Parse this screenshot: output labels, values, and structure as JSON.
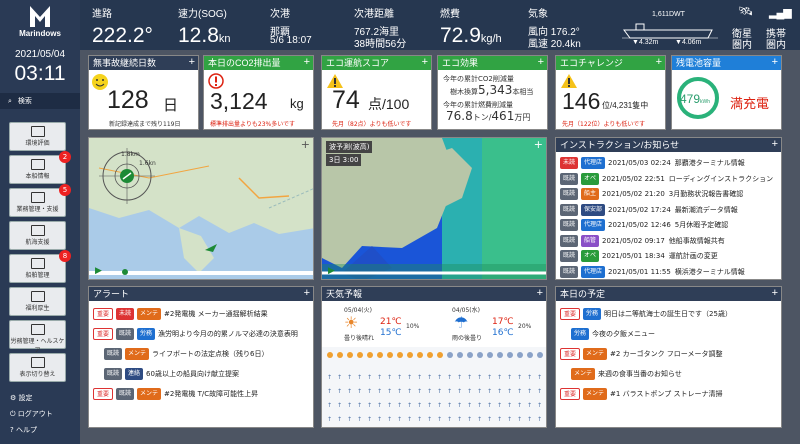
{
  "sidebar": {
    "logo": "Marindows",
    "date": "2021/05/04",
    "time": "03:11",
    "search": "検索",
    "menu": [
      {
        "label": "環境評価",
        "badge": ""
      },
      {
        "label": "本船情報",
        "badge": "2"
      },
      {
        "label": "業務管理・支援",
        "badge": "5"
      },
      {
        "label": "航海支援",
        "badge": ""
      },
      {
        "label": "船舶管理",
        "badge": "8"
      },
      {
        "label": "福利厚生",
        "badge": ""
      },
      {
        "label": "労務管理・ヘルスケア",
        "badge": ""
      },
      {
        "label": "表示切り替え",
        "badge": ""
      }
    ],
    "settings": "設定",
    "logout": "ログアウト",
    "help": "ヘルプ"
  },
  "topbar": {
    "course": {
      "label": "進路",
      "value": "222.2°"
    },
    "speed": {
      "label": "速力(SOG)",
      "value": "12.8",
      "unit": "kn"
    },
    "next_port": {
      "label": "次港",
      "name": "那覇",
      "eta": "5/6 18:07"
    },
    "distance": {
      "label": "次港距離",
      "nm": "767.2海里",
      "time": "38時間56分"
    },
    "fuel": {
      "label": "燃費",
      "value": "72.9",
      "unit": "kg/h"
    },
    "weather": {
      "label": "気象",
      "wind_dir": "風向 176.2°",
      "wind_speed": "風速 20.4kn"
    },
    "ship": {
      "dwt": "1,611DWT",
      "left": "4.32m",
      "right": "4.06m"
    },
    "satellite": {
      "line1": "衛星",
      "line2": "圏内"
    },
    "mobile": {
      "line1": "携帯",
      "line2": "圏内"
    }
  },
  "cards": {
    "no_accident": {
      "title": "無事故継続日数",
      "value": "128",
      "unit": "日",
      "foot": "新記録達成まで残り119日"
    },
    "co2": {
      "title": "本日のCO2排出量",
      "value": "3,124",
      "unit": "kg",
      "foot": "標準排出量よりも23%多いです"
    },
    "eco_score": {
      "title": "エコ運航スコア",
      "value": "74",
      "unit": "点/100",
      "foot": "先月（82点）よりも低いです"
    },
    "eco_effect": {
      "title": "エコ効果",
      "l1": "今年の累計CO2削減量",
      "l2a": "樹木換算",
      "l2b": "5,343",
      "l2c": "本相当",
      "l3": "今年の累計燃費削減量",
      "l4a": "76.8",
      "l4b": "トン/",
      "l4c": "461",
      "l4d": "万円"
    },
    "eco_challenge": {
      "title": "エコチャレンジ",
      "rank": "146",
      "unit": "位/4,231隻中",
      "foot": "先月（122位）よりも低いです"
    },
    "battery": {
      "title": "残電池容量",
      "value": "479",
      "unit": "kWh",
      "status": "満充電"
    },
    "notices": {
      "title": "インストラクション/お知らせ",
      "rows": [
        {
          "t1": "未読",
          "t2": "代理店",
          "c2": "t-blue",
          "time": "2021/05/03 02:24",
          "text": "那覇港ターミナル情報"
        },
        {
          "t1": "既読",
          "t2": "オペ",
          "c2": "t-green",
          "time": "2021/05/02 22:51",
          "text": "ローディングインストラクション"
        },
        {
          "t1": "既読",
          "t2": "船主",
          "c2": "t-orange",
          "time": "2021/05/02 21:20",
          "text": "3月勤務状況報告書確認"
        },
        {
          "t1": "既読",
          "t2": "保安部",
          "c2": "t-navy",
          "time": "2021/05/02 17:24",
          "text": "最新潮流データ情報"
        },
        {
          "t1": "既読",
          "t2": "代理店",
          "c2": "t-blue",
          "time": "2021/05/02 12:46",
          "text": "5月休暇予定確認"
        },
        {
          "t1": "既読",
          "t2": "船管",
          "c2": "t-purple",
          "time": "2021/05/02 09:17",
          "text": "他船事故情報共有"
        },
        {
          "t1": "既読",
          "t2": "オペ",
          "c2": "t-green",
          "time": "2021/05/01 18:34",
          "text": "運航計画の変更"
        },
        {
          "t1": "既読",
          "t2": "代理店",
          "c2": "t-blue",
          "time": "2021/05/01 11:55",
          "text": "横浜港ターミナル情報"
        }
      ]
    },
    "map": {
      "title": "",
      "speed": "1.6kn",
      "dist": "1.8km"
    },
    "wave": {
      "label1": "波予測(波高)",
      "label2": "3日 3:00"
    },
    "alerts": {
      "title": "アラート",
      "rows": [
        {
          "t1": "重要",
          "t2": "未読",
          "t3": "メンテ",
          "text": "#2発電機 メーカー通揺解析結果"
        },
        {
          "t1": "重要",
          "t2": "既読",
          "t3": "労務",
          "text": "漁労明より今月の的累ノルマ必達の決意表明"
        },
        {
          "t1": "",
          "t2": "既読",
          "t3": "メンテ",
          "text": "ライフボートの法定点検（残り6日）"
        },
        {
          "t1": "",
          "t2": "既読",
          "t3": "連絡",
          "text": "60歳以上の船員向け献立提案"
        },
        {
          "t1": "重要",
          "t2": "既読",
          "t3": "メンテ",
          "text": "#2発電機 T/C故障可能性上昇"
        }
      ]
    },
    "weather": {
      "title": "天気予報",
      "d1": {
        "date": "05/04(火)",
        "desc": "曇り後晴れ",
        "hi": "21℃",
        "lo": "15℃",
        "rain": "10%"
      },
      "d2": {
        "date": "04/05(水)",
        "desc": "雨の後曇り",
        "hi": "17℃",
        "lo": "16℃",
        "rain": "20%"
      }
    },
    "schedule": {
      "title": "本日の予定",
      "rows": [
        {
          "t1": "重要",
          "t2": "労務",
          "c2": "t-blue",
          "text": "明日は二等航海士の誕生日です（25歳）"
        },
        {
          "t1": "",
          "t2": "労務",
          "c2": "t-blue",
          "text": "今夜の夕飯メニュー"
        },
        {
          "t1": "重要",
          "t2": "メンテ",
          "c2": "t-orange",
          "text": "#2 カーゴタンク フローメータ調整"
        },
        {
          "t1": "",
          "t2": "メンテ",
          "c2": "t-orange",
          "text": "来週の食事当番のお知らせ"
        },
        {
          "t1": "重要",
          "t2": "メンテ",
          "c2": "t-orange",
          "text": "#1 バラストポンプ ストレーナ清掃"
        }
      ]
    }
  }
}
